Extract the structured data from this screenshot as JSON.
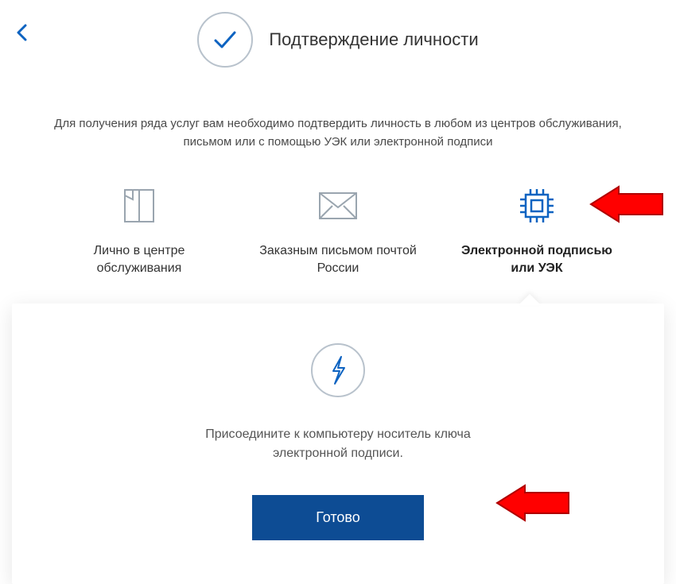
{
  "header": {
    "title": "Подтверждение личности"
  },
  "description": "Для получения ряда услуг вам необходимо подтвердить личность в любом из центров обслуживания, письмом или с помощью УЭК или электронной подписи",
  "options": {
    "inPerson": "Лично в центре обслуживания",
    "byMail": "Заказным письмом почтой России",
    "bySignature": "Электронной подписью или УЭК"
  },
  "panel": {
    "instruction": "Присоедините к компьютеру носитель ключа электронной подписи.",
    "button": "Готово"
  },
  "colors": {
    "accent": "#0d63c1",
    "buttonBg": "#0d4c94"
  }
}
